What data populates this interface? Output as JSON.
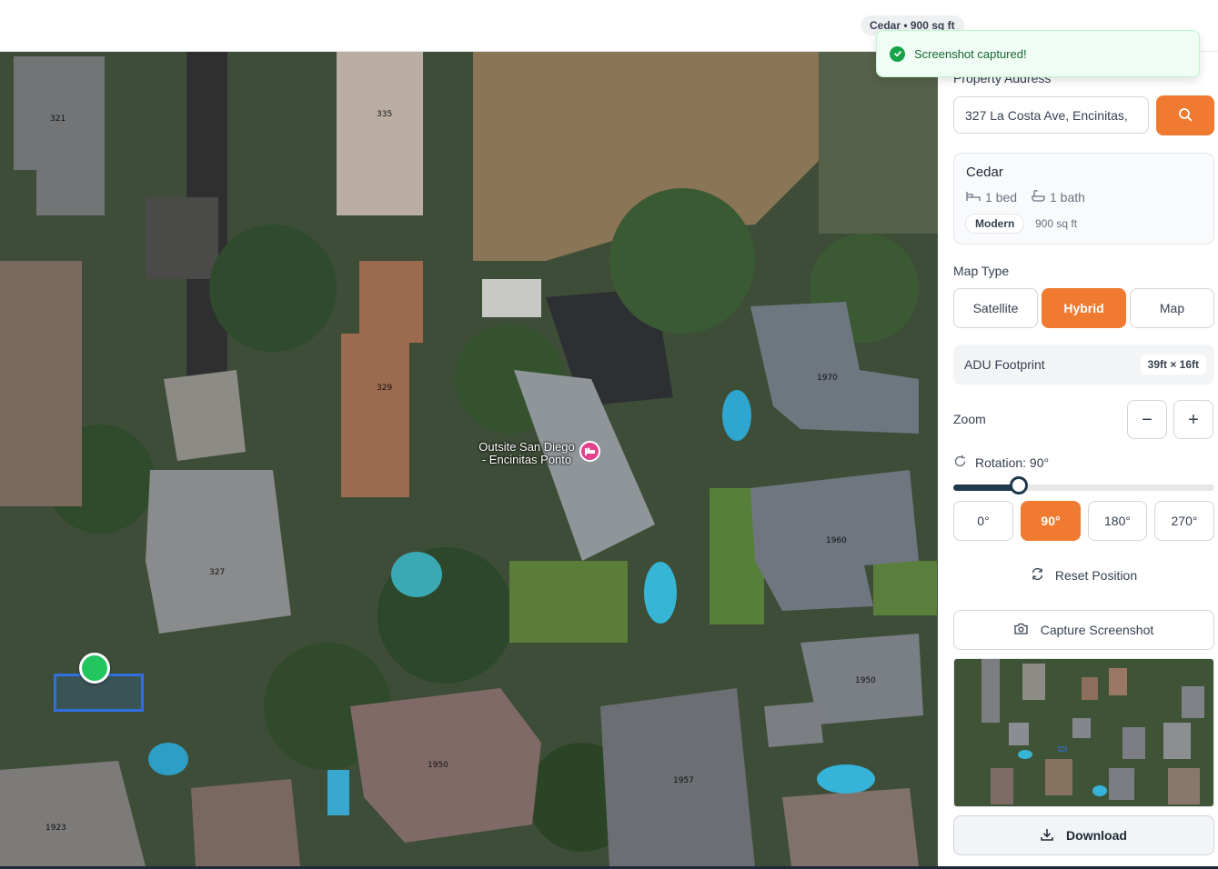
{
  "header": {
    "model_badge": "Cedar • 900 sq ft"
  },
  "toast": {
    "message": "Screenshot captured!"
  },
  "map": {
    "house_numbers": [
      "321",
      "335",
      "329",
      "327",
      "1970",
      "1960",
      "1950",
      "1950",
      "1957",
      "1923"
    ],
    "poi": {
      "name_line1": "Outsite San Diego",
      "name_line2": "- Encinitas Ponto",
      "icon": "hotel-icon"
    }
  },
  "sidebar": {
    "address": {
      "label": "Property Address",
      "value": "327 La Costa Ave, Encinitas,",
      "search_icon": "search-icon"
    },
    "model": {
      "name": "Cedar",
      "beds": "1 bed",
      "baths": "1 bath",
      "style": "Modern",
      "sqft": "900 sq ft"
    },
    "map_type": {
      "label": "Map Type",
      "options": [
        "Satellite",
        "Hybrid",
        "Map"
      ],
      "selected": "Hybrid"
    },
    "footprint": {
      "label": "ADU Footprint",
      "value": "39ft × 16ft"
    },
    "zoom": {
      "label": "Zoom",
      "minus": "−",
      "plus": "+"
    },
    "rotation": {
      "label": "Rotation: 90°",
      "value_fraction": 0.25,
      "options": [
        "0°",
        "90°",
        "180°",
        "270°"
      ],
      "selected": "90°"
    },
    "reset_label": "Reset Position",
    "capture_label": "Capture Screenshot",
    "download_label": "Download"
  },
  "colors": {
    "accent": "#f07a2f",
    "slider": "#1f3a4d",
    "adu_outline": "#2f6fe0",
    "handle": "#22c55e",
    "toast_bg": "#f0fdf4",
    "toast_text": "#166534"
  }
}
